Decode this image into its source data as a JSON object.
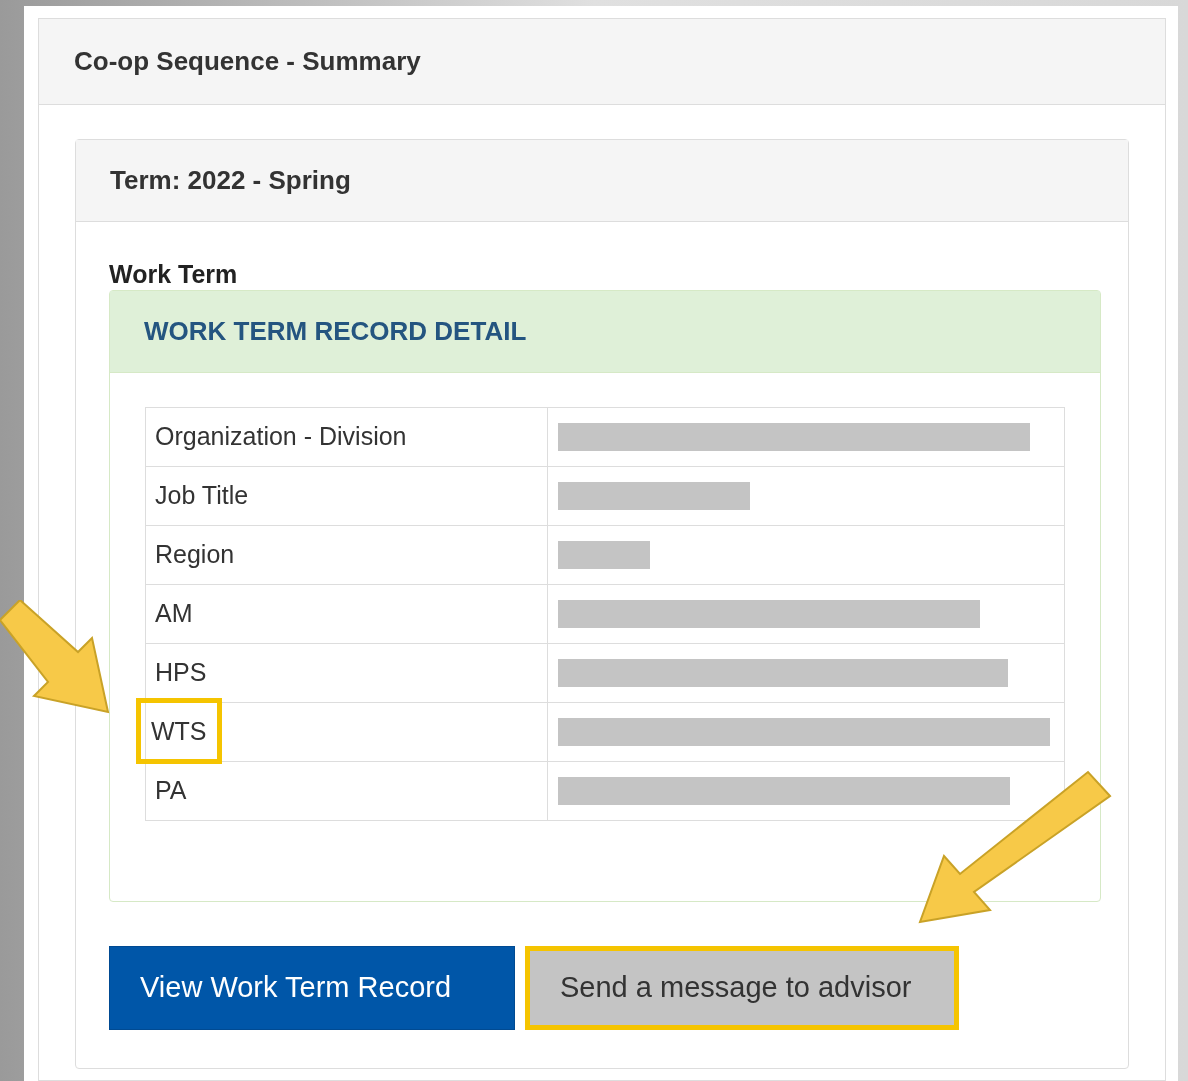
{
  "panel": {
    "title": "Co-op Sequence - Summary"
  },
  "term": {
    "title": "Term: 2022 - Spring",
    "section_label": "Work Term"
  },
  "record": {
    "title": "WORK TERM RECORD DETAIL",
    "rows": [
      {
        "label": "Organization - Division",
        "redacted": true,
        "highlighted": false
      },
      {
        "label": "Job Title",
        "redacted": true,
        "highlighted": false
      },
      {
        "label": "Region",
        "redacted": true,
        "highlighted": false
      },
      {
        "label": "AM",
        "redacted": true,
        "highlighted": false
      },
      {
        "label": "HPS",
        "redacted": true,
        "highlighted": false
      },
      {
        "label": "WTS",
        "redacted": true,
        "highlighted": true
      },
      {
        "label": "PA",
        "redacted": true,
        "highlighted": false
      }
    ]
  },
  "buttons": [
    {
      "label": "View Work Term Record",
      "kind": "primary",
      "highlighted": false
    },
    {
      "label": "Send a message to advisor",
      "kind": "secondary",
      "highlighted": true
    }
  ]
}
